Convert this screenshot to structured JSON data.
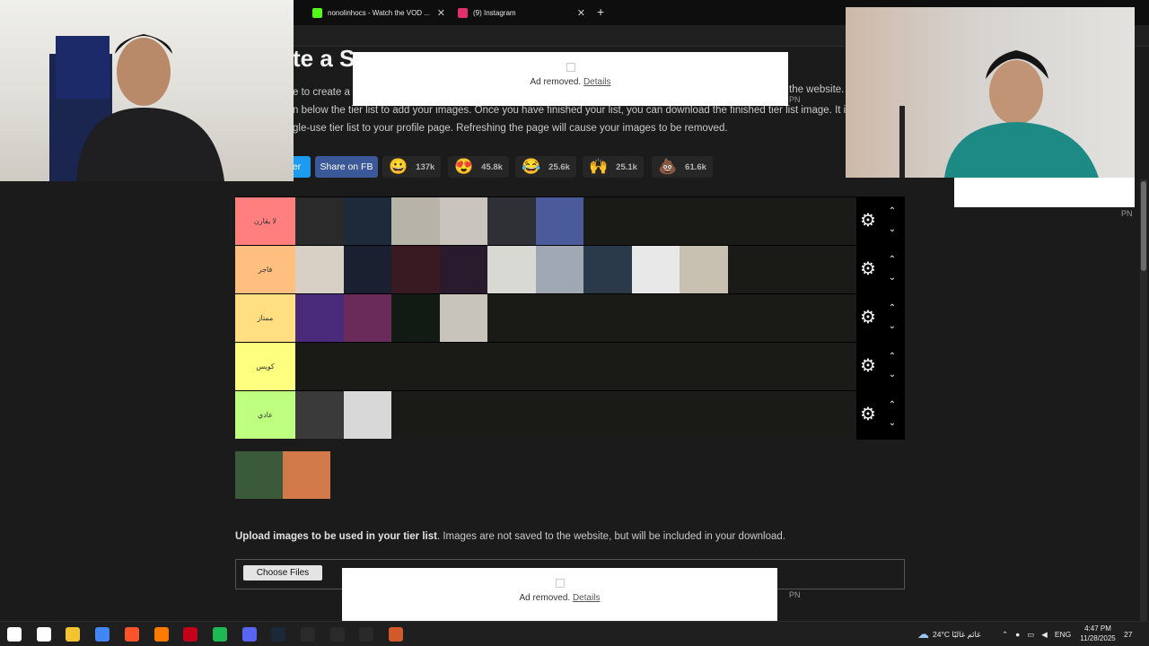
{
  "browser": {
    "tabs": [
      {
        "title": "nonolinhocs - Watch the VOD ...",
        "favicon_color": "#53fc18"
      },
      {
        "title": "(9) Instagram",
        "favicon_color": "#e1306c"
      }
    ],
    "new_tab_symbol": "+",
    "close_symbol": "✕"
  },
  "page": {
    "title_fragment": "te a S",
    "intro_lines": [
      "e to create a",
      "n below the tier list to add your images. Once you have finished your list, you can download the finished tier list image. It is",
      "gle-use tier list to your profile page. Refreshing the page will cause your images to be removed."
    ],
    "intro_right": "the website.",
    "share": {
      "twitter_label": "tter",
      "facebook_label": "Share on FB"
    },
    "reactions": [
      {
        "icon": "grinning-face",
        "glyph": "😀",
        "count": "137k"
      },
      {
        "icon": "heart-eyes",
        "glyph": "😍",
        "count": "45.8k"
      },
      {
        "icon": "laughing-face",
        "glyph": "😂",
        "count": "25.6k"
      },
      {
        "icon": "raised-hands",
        "glyph": "🙌",
        "count": "25.1k"
      },
      {
        "icon": "poop",
        "glyph": "💩",
        "count": "61.6k"
      }
    ]
  },
  "tiers": [
    {
      "label": "لا يقارن",
      "color": "#ff7f7f",
      "items": [
        "#2a2a2a",
        "#1d2a3a",
        "#b8b3a8",
        "#c9c4bd",
        "#2f2f36",
        "#4a5a9a"
      ]
    },
    {
      "label": "فاجر",
      "color": "#ffbf7f",
      "items": [
        "#d8d0c4",
        "#1a2030",
        "#3a1a22",
        "#2a1a2e",
        "#d9d9d4",
        "#a0a8b4",
        "#2a3a4a",
        "#e8e8e8",
        "#c8c0b0"
      ]
    },
    {
      "label": "ممتاز",
      "color": "#ffdf7f",
      "items": [
        "#4a2a7a",
        "#6a2a5a",
        "#121a14",
        "#c8c4bc"
      ]
    },
    {
      "label": "كويس",
      "color": "#ffff7f",
      "items": []
    },
    {
      "label": "عادي",
      "color": "#bfff7f",
      "items": [
        "#3a3a3a",
        "#d8d8d8"
      ]
    }
  ],
  "pool_items": [
    "#3b5a3a",
    "#d27a4a"
  ],
  "upload": {
    "bold": "Upload images to be used in your tier list",
    "rest": ". Images are not saved to the website, but will be included in your download.",
    "choose_label": "Choose Files"
  },
  "ads": {
    "removed_text": "Ad removed.",
    "details_label": "Details",
    "pn_label": "PN"
  },
  "taskbar": {
    "weather": "24°C  غائم غالبًا",
    "lang": "ENG",
    "time": "4:47 PM",
    "date": "11/28/2025",
    "notifications": "27",
    "app_colors": [
      "#ffffff",
      "#ffffff",
      "#f4c430",
      "#4285f4",
      "#fb542b",
      "#ff7a00",
      "#c2001a",
      "#1db954",
      "#5865f2",
      "#1b2838",
      "#2a2a2a",
      "#2a2a2a",
      "#2a2a2a",
      "#d25a2a"
    ]
  }
}
